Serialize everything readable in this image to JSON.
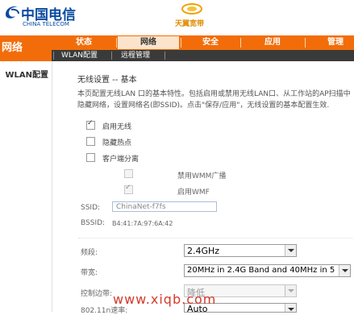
{
  "header": {
    "logo_cn": "中国电信",
    "logo_en": "CHINA TELECOM",
    "brand": "天翼宽带"
  },
  "sidebar": {
    "section_title": "网络",
    "items": [
      {
        "label": "WLAN配置"
      }
    ]
  },
  "main_tabs": [
    {
      "label": "状态",
      "active": false
    },
    {
      "label": "网络",
      "active": true
    },
    {
      "label": "安全",
      "active": false
    },
    {
      "label": "应用",
      "active": false
    },
    {
      "label": "管理",
      "active": false
    }
  ],
  "sub_tabs": [
    {
      "label": "WLAN配置"
    },
    {
      "label": "远程管理"
    }
  ],
  "content": {
    "title": "无线设置 -- 基本",
    "description": "本页配置无线LAN 口的基本特性。包括启用或禁用无线LAN口、从工作站的AP扫描中隐藏网络，设置网络名(即SSID)。点击\"保存/应用\"，无线设置的基本配置生效.",
    "checkboxes": [
      {
        "label": "启用无线",
        "checked": true,
        "disabled": false
      },
      {
        "label": "隐藏热点",
        "checked": false,
        "disabled": false
      },
      {
        "label": "客户端分离",
        "checked": false,
        "disabled": false
      },
      {
        "label": "禁用WMM广播",
        "checked": false,
        "disabled": true
      },
      {
        "label": "启用WMF",
        "checked": true,
        "disabled": true
      }
    ],
    "ssid_label": "SSID:",
    "ssid_value": "ChinaNet-f7fs",
    "bssid_label": "BSSID:",
    "bssid_value": "B4:41:7A:97:6A:42",
    "band_label": "频段:",
    "band_value": "2.4GHz",
    "bandwidth_label": "带宽:",
    "bandwidth_value": "20MHz in 2.4G Band and 40MHz in 5",
    "sideband_label": "控制边带:",
    "sideband_value": "降低",
    "mode_label": "802.11n速率:",
    "mode_value": "Auto"
  },
  "watermark": "www.xiqb.com",
  "colors": {
    "nav_orange": "#f26d0a",
    "subnav_dark": "#3a3a3a",
    "brand_blue": "#0a4aa0"
  }
}
